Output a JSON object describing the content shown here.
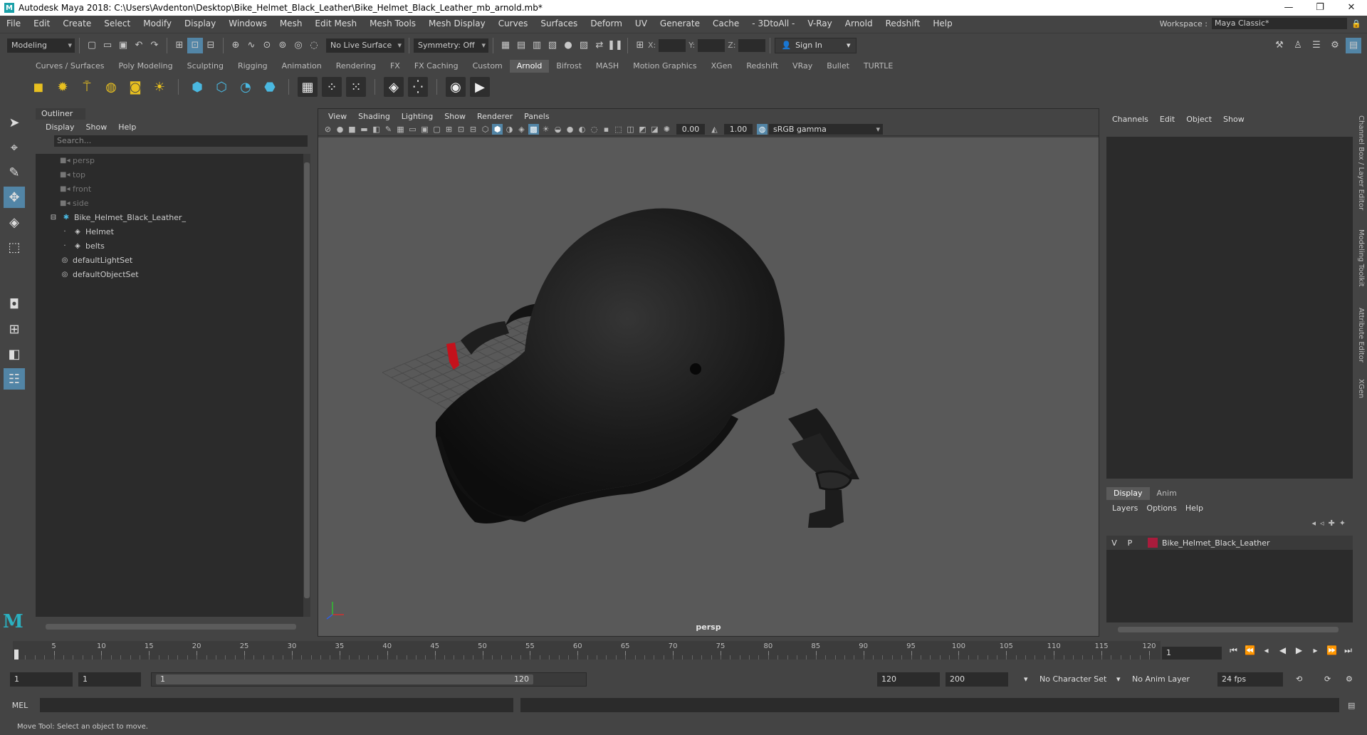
{
  "window": {
    "app_icon": "M",
    "title": "Autodesk Maya 2018: C:\\Users\\Avdenton\\Desktop\\Bike_Helmet_Black_Leather\\Bike_Helmet_Black_Leather_mb_arnold.mb*",
    "controls": [
      "minimize-icon",
      "maximize-icon",
      "close-icon"
    ]
  },
  "menubar": {
    "items": [
      "File",
      "Edit",
      "Create",
      "Select",
      "Modify",
      "Display",
      "Windows",
      "Mesh",
      "Edit Mesh",
      "Mesh Tools",
      "Mesh Display",
      "Curves",
      "Surfaces",
      "Deform",
      "UV",
      "Generate",
      "Cache",
      "- 3DtoAll -",
      "V-Ray",
      "Arnold",
      "Redshift",
      "Help"
    ],
    "workspace_label": "Workspace :",
    "workspace_value": "Maya Classic*"
  },
  "statusline": {
    "mode": "Modeling",
    "live_surface": "No Live Surface",
    "symmetry": "Symmetry: Off",
    "x_label": "X:",
    "y_label": "Y:",
    "z_label": "Z:",
    "sign_in": "Sign In"
  },
  "shelf": {
    "tabs": [
      "Curves / Surfaces",
      "Poly Modeling",
      "Sculpting",
      "Rigging",
      "Animation",
      "Rendering",
      "FX",
      "FX Caching",
      "Custom",
      "Arnold",
      "Bifrost",
      "MASH",
      "Motion Graphics",
      "XGen",
      "Redshift",
      "VRay",
      "Bullet",
      "TURTLE"
    ],
    "active_tab": "Arnold"
  },
  "outliner": {
    "title": "Outliner",
    "menus": [
      "Display",
      "Show",
      "Help"
    ],
    "search_placeholder": "Search...",
    "items": [
      {
        "label": "persp",
        "kind": "camera"
      },
      {
        "label": "top",
        "kind": "camera"
      },
      {
        "label": "front",
        "kind": "camera"
      },
      {
        "label": "side",
        "kind": "camera"
      },
      {
        "label": "Bike_Helmet_Black_Leather_",
        "kind": "group"
      },
      {
        "label": "Helmet",
        "kind": "mesh"
      },
      {
        "label": "belts",
        "kind": "mesh"
      },
      {
        "label": "defaultLightSet",
        "kind": "set"
      },
      {
        "label": "defaultObjectSet",
        "kind": "set"
      }
    ]
  },
  "viewport": {
    "menus": [
      "View",
      "Shading",
      "Lighting",
      "Show",
      "Renderer",
      "Panels"
    ],
    "exposure": "0.00",
    "gamma": "1.00",
    "color_space": "sRGB gamma",
    "camera": "persp"
  },
  "channelbox": {
    "menus": [
      "Channels",
      "Edit",
      "Object",
      "Show"
    ],
    "layer_tabs": [
      "Display",
      "Anim"
    ],
    "layer_menus": [
      "Layers",
      "Options",
      "Help"
    ],
    "layer": {
      "v": "V",
      "p": "P",
      "name": "Bike_Helmet_Black_Leather",
      "color": "#a81c3c"
    }
  },
  "right_tabs": [
    "Channel Box / Layer Editor",
    "Modeling Toolkit",
    "Attribute Editor",
    "XGen"
  ],
  "timeline": {
    "ticks": [
      "1",
      "5",
      "10",
      "15",
      "20",
      "25",
      "30",
      "35",
      "40",
      "45",
      "50",
      "55",
      "60",
      "65",
      "70",
      "75",
      "80",
      "85",
      "90",
      "95",
      "100",
      "105",
      "110",
      "115",
      "120"
    ],
    "current_frame": "1"
  },
  "range": {
    "start": "1",
    "anim_start": "1",
    "slider_start": "1",
    "slider_end": "120",
    "anim_end": "120",
    "end": "200",
    "character_set": "No Character Set",
    "anim_layer": "No Anim Layer",
    "fps": "24 fps"
  },
  "cmdline": {
    "label": "MEL"
  },
  "helpline": {
    "text": "Move Tool: Select an object to move."
  }
}
